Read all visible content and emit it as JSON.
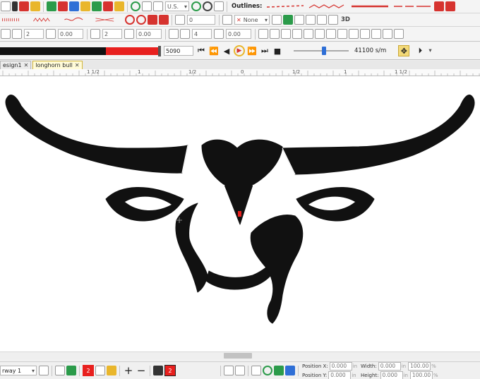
{
  "toolbar1": {
    "units_value": "U.S.",
    "outlines_label": "Outlines:"
  },
  "toolbar2": {
    "angle_value": "0",
    "color_none_label": "None",
    "threed_label": "3D"
  },
  "toolbar3": {
    "field_a": "2",
    "field_b": "0.00",
    "field_c": "2",
    "field_d": "0.00",
    "field_e": "4",
    "field_f": "0.00"
  },
  "playback": {
    "stitch_position": "5090",
    "speed": "41100 s/m",
    "progress_fraction": 0.33
  },
  "tabs": [
    {
      "label": "esign1",
      "closable": true,
      "active": false
    },
    {
      "label": "longhorn bull",
      "closable": true,
      "active": true
    }
  ],
  "ruler": {
    "labels": [
      "1 1/2",
      "1",
      "1/2",
      "0",
      "1/2",
      "1",
      "1 1/2"
    ]
  },
  "statusbar": {
    "hoop_value": "rway 1",
    "color_count": "2",
    "layer_count": "2",
    "position_x_label": "Position X:",
    "position_x_value": "0.000",
    "position_x_unit": "in",
    "position_y_label": "Position Y:",
    "position_y_value": "0.000",
    "position_y_unit": "in",
    "width_label": "Width:",
    "width_value": "0.000",
    "width_unit": "in",
    "width_pct": "100.00",
    "height_label": "Height:",
    "height_value": "0.000",
    "height_unit": "in",
    "height_pct": "100.00",
    "pct_symbol": "%"
  },
  "colors": {
    "accent_red": "#e8201e",
    "stitch_black": "#111111",
    "tab_active": "#fffbd8"
  }
}
